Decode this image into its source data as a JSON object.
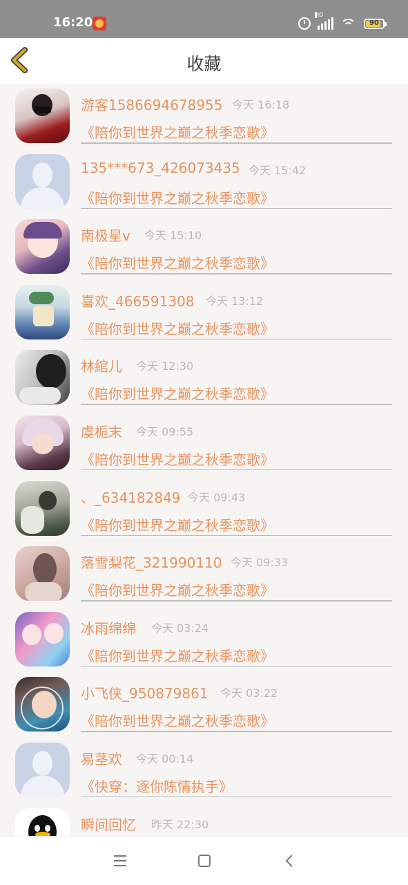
{
  "status_bar": {
    "time": "16:20",
    "battery": "90",
    "network": "HD"
  },
  "header": {
    "title": "收藏",
    "back_icon": "chevron-left-icon",
    "accent_color": "#d4a017"
  },
  "colors": {
    "name": "#e8935e",
    "time": "#b9b9b9",
    "background": "#f7f4f4"
  },
  "items": [
    {
      "name": "游客1586694678955",
      "time": "今天 16:18",
      "title": "《陪你到世界之巅之秋季恋歌》",
      "avatar": "photo-avatar"
    },
    {
      "name": "135***673_426073435",
      "time": "今天 15:42",
      "title": "《陪你到世界之巅之秋季恋歌》",
      "avatar": "default-avatar"
    },
    {
      "name": "南极星v",
      "time": "今天 15:10",
      "title": "《陪你到世界之巅之秋季恋歌》",
      "avatar": "photo-avatar"
    },
    {
      "name": "喜欢_466591308",
      "time": "今天 13:12",
      "title": "《陪你到世界之巅之秋季恋歌》",
      "avatar": "photo-avatar"
    },
    {
      "name": "林綰儿",
      "time": "今天 12:30",
      "title": "《陪你到世界之巅之秋季恋歌》",
      "avatar": "photo-avatar"
    },
    {
      "name": "虞栀末",
      "time": "今天 09:55",
      "title": "《陪你到世界之巅之秋季恋歌》",
      "avatar": "photo-avatar"
    },
    {
      "name": "、_634182849",
      "time": "今天 09:43",
      "title": "《陪你到世界之巅之秋季恋歌》",
      "avatar": "photo-avatar"
    },
    {
      "name": "落雪梨花_321990110",
      "time": "今天 09:33",
      "title": "《陪你到世界之巅之秋季恋歌》",
      "avatar": "photo-avatar"
    },
    {
      "name": "冰雨绵绵",
      "time": "今天 03:24",
      "title": "《陪你到世界之巅之秋季恋歌》",
      "avatar": "photo-avatar"
    },
    {
      "name": "小飞侠_950879861",
      "time": "今天 03:22",
      "title": "《陪你到世界之巅之秋季恋歌》",
      "avatar": "photo-avatar"
    },
    {
      "name": "易茎欢",
      "time": "今天 00:14",
      "title": "《快穿：逐你陈情执手》",
      "avatar": "default-avatar"
    },
    {
      "name": "瞬间回忆",
      "time": "昨天 22:30",
      "title": "",
      "avatar": "qq-penguin-avatar"
    }
  ],
  "nav": {
    "menu_icon": "menu-icon",
    "home_icon": "home-square-icon",
    "back_icon": "back-triangle-icon"
  }
}
